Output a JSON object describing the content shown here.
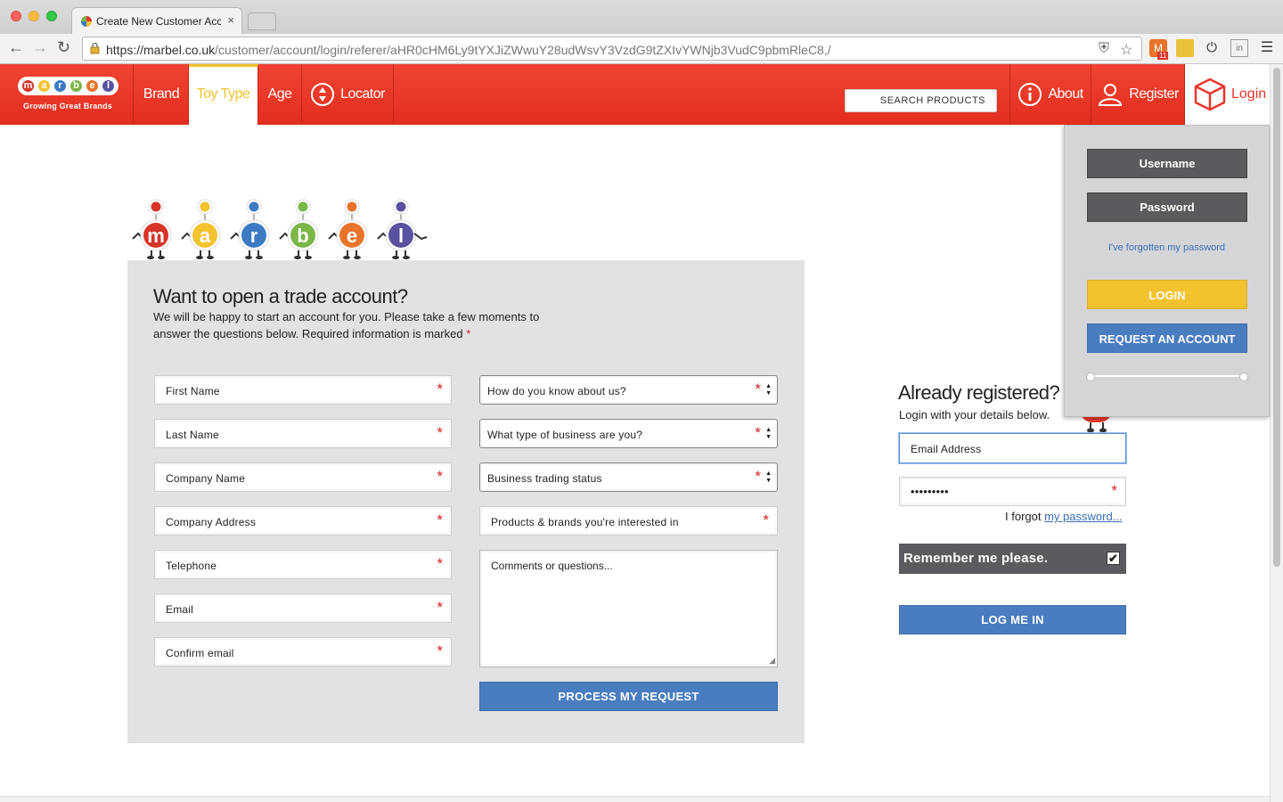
{
  "browser": {
    "tab_title": "Create New Customer Account",
    "tab_close": "×",
    "url_host": "https://marbel.co.uk",
    "url_path": "/customer/account/login/referer/aHR0cHM6Ly9tYXJiZWwuY28udWsvY3VzdG9tZXIvYWNjb3VudC9pbmRleC8,/",
    "ext_badge": "11"
  },
  "header": {
    "logo_letters": [
      "m",
      "a",
      "r",
      "b",
      "e",
      "l"
    ],
    "logo_colors": [
      "#d7342a",
      "#f3c22f",
      "#3c7ac4",
      "#7ab648",
      "#e8742c",
      "#5a52a0"
    ],
    "logo_tagline": "Growing Great Brands",
    "nav": {
      "brand": "Brand",
      "toy_type": "Toy Type",
      "age": "Age",
      "locator": "Locator",
      "about": "About",
      "register": "Register",
      "login": "Login"
    },
    "search_placeholder": "SEARCH PRODUCTS",
    "brand_red": "#e8352a",
    "accent_yellow": "#f3c22f"
  },
  "trade_form": {
    "title": "Want to open a trade account?",
    "intro": "We will be happy to start an account for you. Please take a few moments to answer the questions below. Required information is marked",
    "required_mark": "*",
    "left_fields": [
      "First Name",
      "Last Name",
      "Company Name",
      "Company Address",
      "Telephone",
      "Email",
      "Confirm email"
    ],
    "right_selects": [
      "How do you know about us?",
      "What type of business are you?",
      "Business trading status"
    ],
    "products_field": "Products & brands you're interested in",
    "comments_placeholder": "Comments or questions...",
    "submit_label": "PROCESS MY REQUEST"
  },
  "login_form": {
    "title": "Already registered?",
    "subtitle": "Login with your details below.",
    "email_placeholder": "Email Address",
    "password_value": "•••••••••",
    "forgot_prefix": "I forgot",
    "forgot_link": "my password...",
    "remember_label": "Remember me please.",
    "remember_checked": "✔",
    "submit_label": "LOG ME IN"
  },
  "dropdown": {
    "username": "Username",
    "password": "Password",
    "forgot": "I've forgotten my password",
    "login": "LOGIN",
    "request": "REQUEST AN ACCOUNT"
  }
}
